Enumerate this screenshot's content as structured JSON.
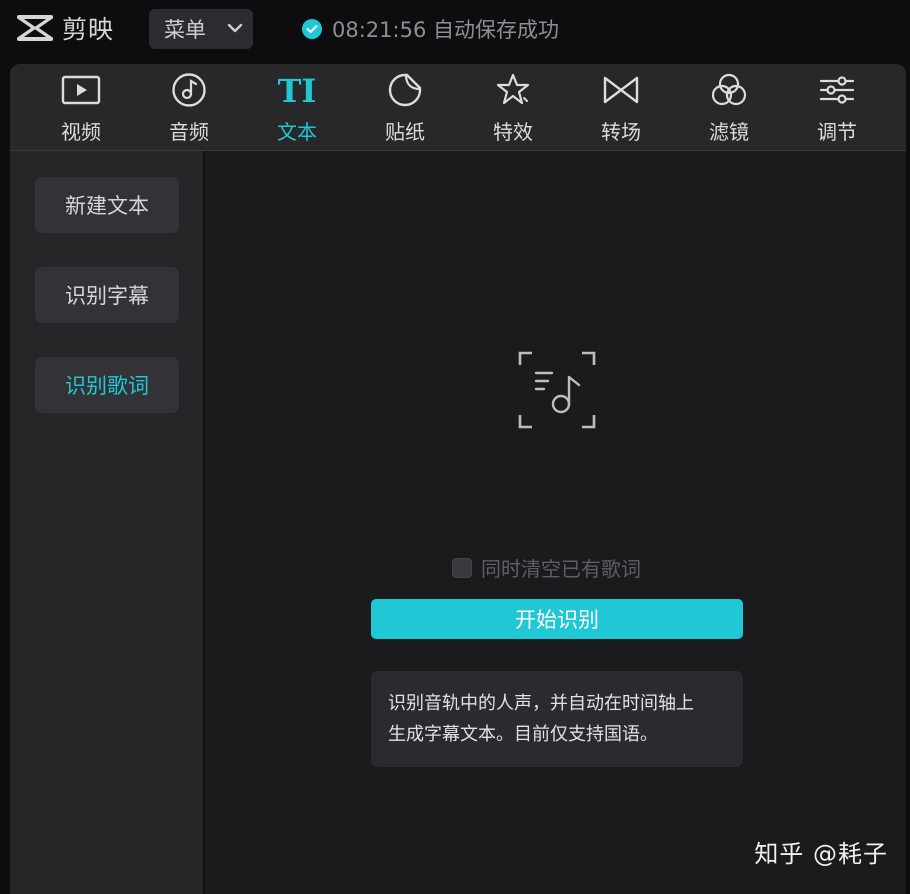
{
  "app": {
    "name": "剪映"
  },
  "menu": {
    "label": "菜单"
  },
  "status": {
    "time": "08:21:56",
    "message": "自动保存成功"
  },
  "tabs": [
    {
      "label": "视频",
      "icon": "video-icon"
    },
    {
      "label": "音频",
      "icon": "audio-icon"
    },
    {
      "label": "文本",
      "icon": "text-icon",
      "active": true
    },
    {
      "label": "贴纸",
      "icon": "sticker-icon"
    },
    {
      "label": "特效",
      "icon": "effects-icon"
    },
    {
      "label": "转场",
      "icon": "transition-icon"
    },
    {
      "label": "滤镜",
      "icon": "filter-icon"
    },
    {
      "label": "调节",
      "icon": "adjust-icon"
    }
  ],
  "sidebar": {
    "items": [
      {
        "label": "新建文本"
      },
      {
        "label": "识别字幕"
      },
      {
        "label": "识别歌词",
        "active": true
      }
    ]
  },
  "main": {
    "icon": "lyrics-recognition-icon",
    "clear_checkbox": {
      "label": "同时清空已有歌词",
      "checked": false
    },
    "start_button": "开始识别",
    "info_line1": "识别音轨中的人声，并自动在时间轴上",
    "info_line2": "生成字幕文本。目前仅支持国语。"
  },
  "watermark": "知乎 @耗子",
  "colors": {
    "accent": "#1fc8d4",
    "background": "#0d0d0f",
    "panel": "#1d1d20"
  }
}
